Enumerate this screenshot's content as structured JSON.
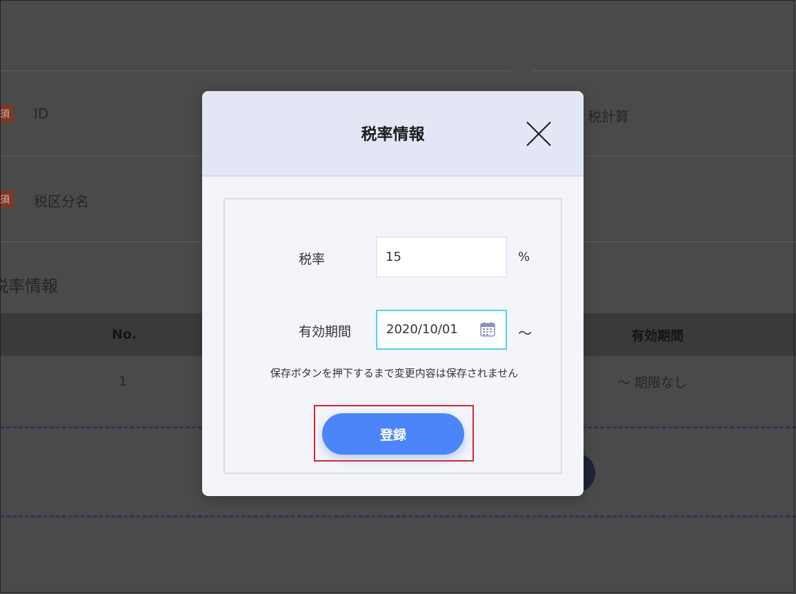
{
  "background": {
    "required_badge": "須",
    "id_label": "ID",
    "tax_calc_label": "税計算",
    "tax_category_label": "税区分名",
    "section_title": "税率情報",
    "table": {
      "headers": [
        "No.",
        "有効期間"
      ],
      "row": {
        "no": "1",
        "period": "〜 期限なし"
      }
    }
  },
  "modal": {
    "title": "税率情報",
    "tax_rate": {
      "label": "税率",
      "value": "15",
      "unit": "%"
    },
    "valid_period": {
      "label": "有効期間",
      "value": "2020/10/01",
      "suffix": "〜"
    },
    "note": "保存ボタンを押下するまで変更内容は保存されません",
    "submit_label": "登録"
  },
  "colors": {
    "accent": "#4c85f7",
    "highlight": "#d9232a",
    "focus": "#4fd3e6"
  }
}
